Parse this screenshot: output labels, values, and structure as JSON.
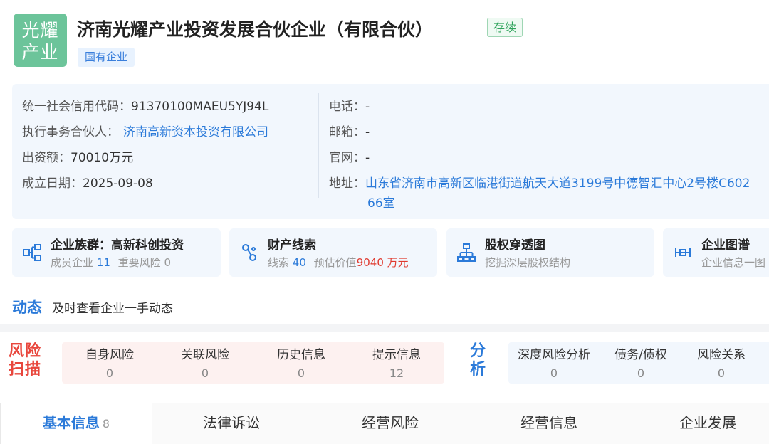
{
  "company": {
    "logo_text_line1": "光耀",
    "logo_text_line2": "产业",
    "name": "济南光耀产业投资发展合伙企业（有限合伙）",
    "status": "存续",
    "type_badge": "国有企业"
  },
  "info": {
    "credit_code_label": "统一社会信用代码：",
    "credit_code": "91370100MAEU5YJ94L",
    "partner_label": "执行事务合伙人：",
    "partner": "济南高新资本投资有限公司",
    "capital_label": "出资额：",
    "capital": "70010万元",
    "founded_label": "成立日期：",
    "founded": "2025-09-08",
    "phone_label": "电话：",
    "phone": "-",
    "email_label": "邮箱：",
    "email": "-",
    "website_label": "官网：",
    "website": "-",
    "address_label": "地址：",
    "address_line1": "山东省济南市高新区临港街道航天大道3199号中德智汇中心2号楼C602",
    "address_line2": "66室"
  },
  "cards": {
    "group": {
      "title": "企业族群：高新科创投资",
      "members_label": "成员企业",
      "members": "11",
      "risk_label": "重要风险",
      "risk": "0"
    },
    "clues": {
      "title": "财产线索",
      "clues_label": "线索",
      "clues": "40",
      "value_label": "预估价值",
      "value": "9040 万元"
    },
    "equity": {
      "title": "股权穿透图",
      "sub": "挖掘深层股权结构"
    },
    "graph": {
      "title": "企业图谱",
      "sub": "企业信息一图"
    }
  },
  "dynamic": {
    "title": "动态",
    "text": "及时查看企业一手动态"
  },
  "risk": {
    "logo_line1": "风险",
    "logo_line2": "扫描",
    "items": [
      {
        "label": "自身风险",
        "value": "0"
      },
      {
        "label": "关联风险",
        "value": "0"
      },
      {
        "label": "历史信息",
        "value": "0"
      },
      {
        "label": "提示信息",
        "value": "12"
      }
    ]
  },
  "analysis": {
    "logo_line1": "分",
    "logo_line2": "析",
    "items": [
      {
        "label": "深度风险分析",
        "value": "0"
      },
      {
        "label": "债务/债权",
        "value": "0"
      },
      {
        "label": "风险关系",
        "value": "0"
      }
    ]
  },
  "tabs": [
    {
      "label": "基本信息",
      "count": "8"
    },
    {
      "label": "法律诉讼"
    },
    {
      "label": "经营风险"
    },
    {
      "label": "经营信息"
    },
    {
      "label": "企业发展"
    }
  ],
  "colors": {
    "accent": "#2b7ad9",
    "logo_bg": "#6cc49a",
    "risk_red": "#e8463c",
    "status_green": "#2ea35b"
  }
}
